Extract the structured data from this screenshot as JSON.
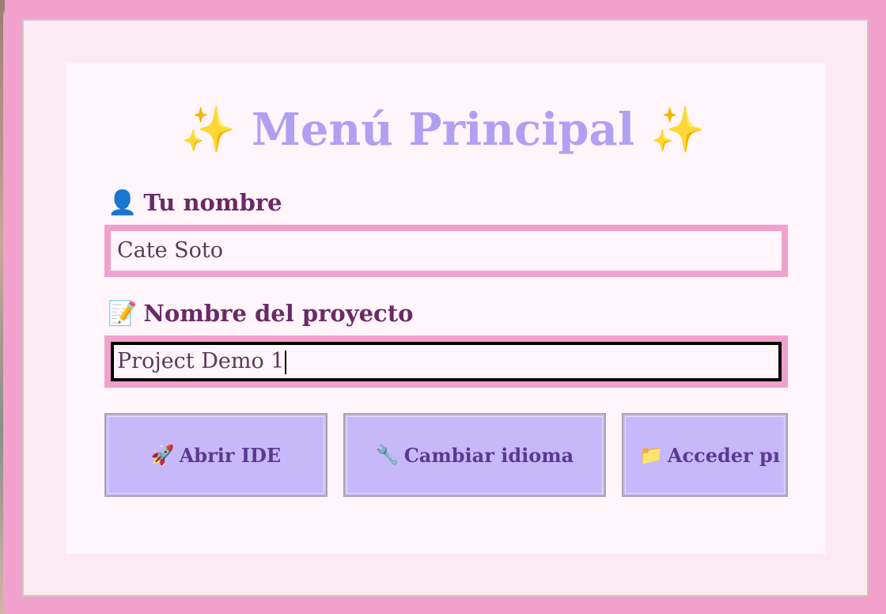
{
  "title": {
    "spark_left": "✨",
    "text": "Menú Principal",
    "spark_right": "✨"
  },
  "name_field": {
    "icon": "👤",
    "label": "Tu nombre",
    "value": "Cate Soto"
  },
  "project_field": {
    "icon": "📝",
    "label": "Nombre del proyecto",
    "value": "Project Demo 1"
  },
  "buttons": [
    {
      "icon": "🚀",
      "label": "Abrir IDE"
    },
    {
      "icon": "🔧",
      "label": "Cambiar idioma"
    },
    {
      "icon": "📁",
      "label": "Acceder pı"
    }
  ],
  "colors": {
    "frame": "#f2a1cc",
    "title": "#b19ff2",
    "label": "#6a2a66",
    "button_bg": "#c7b8fa",
    "button_text": "#5a3a90"
  }
}
